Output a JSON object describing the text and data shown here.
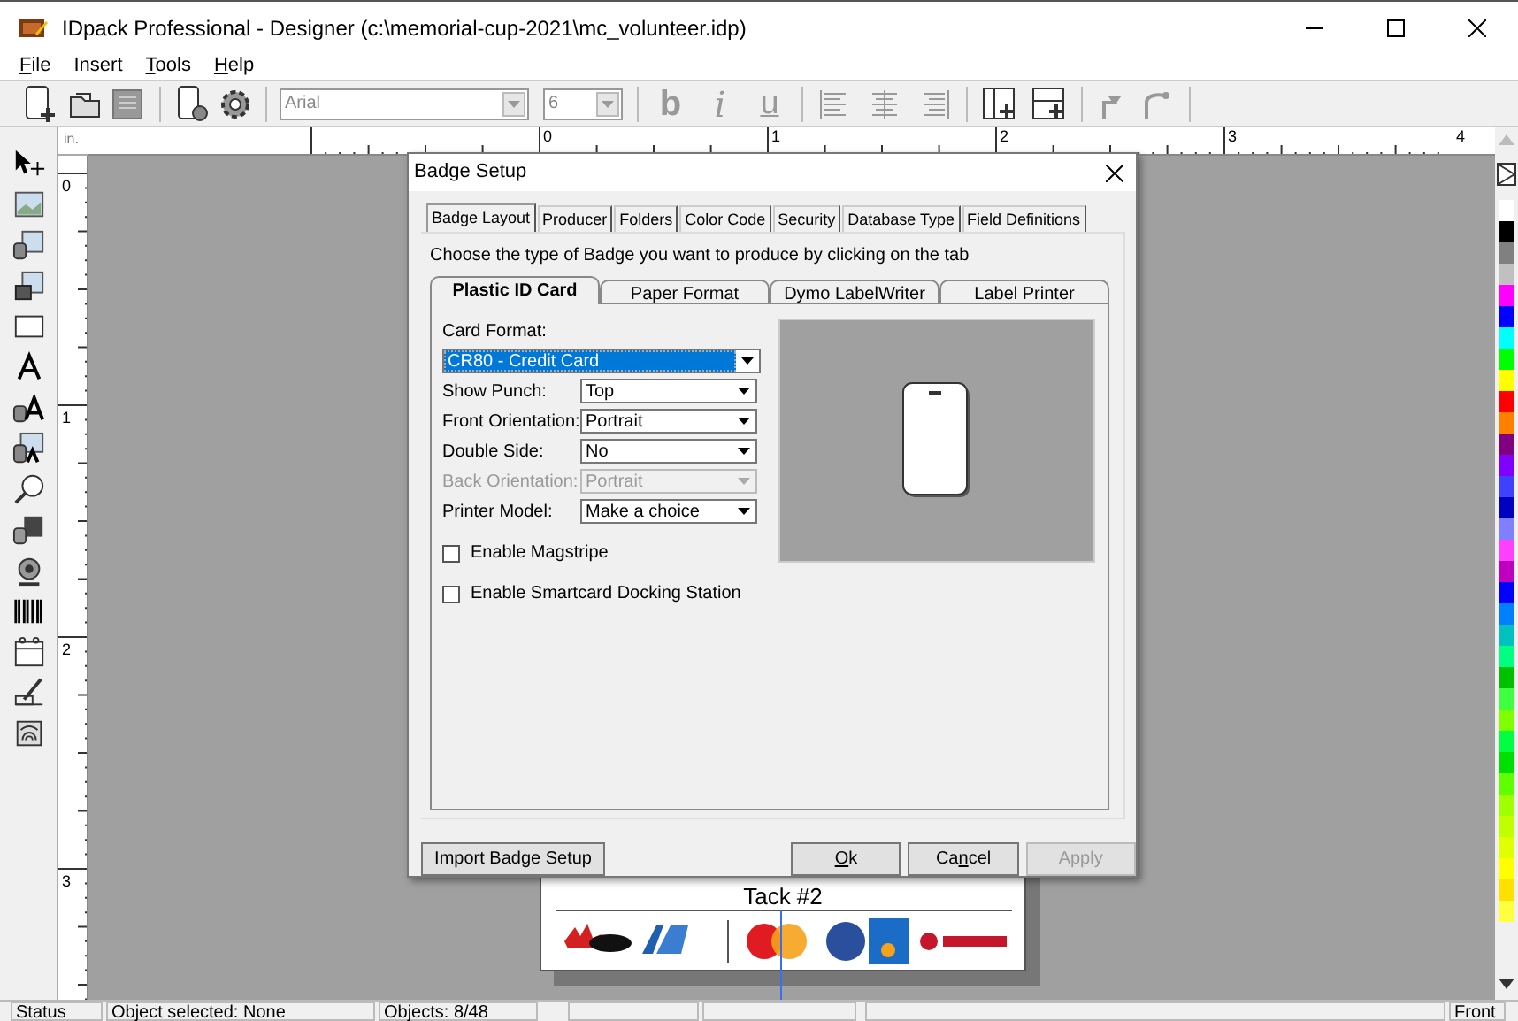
{
  "window": {
    "title": "IDpack Professional - Designer (c:\\memorial-cup-2021\\mc_volunteer.idp)"
  },
  "menu": [
    {
      "key": "F",
      "rest": "ile"
    },
    {
      "label": "Insert"
    },
    {
      "key": "T",
      "rest": "ools"
    },
    {
      "key": "H",
      "rest": "elp"
    }
  ],
  "toolbar": {
    "font": "Arial",
    "size": "6",
    "bold": "b",
    "italic": "i",
    "underline": "u"
  },
  "ruler": {
    "unit": "in.",
    "x_labels": [
      "0",
      "1",
      "2",
      "3",
      "4"
    ],
    "y_labels": [
      "0",
      "1",
      "2",
      "3"
    ]
  },
  "badge": {
    "text": "Tack #2"
  },
  "dialog": {
    "title": "Badge Setup",
    "tabs": [
      {
        "label": "Badge Layout",
        "selected": true
      },
      {
        "label": "Producer",
        "selected": false
      },
      {
        "label": "Folders",
        "selected": false
      },
      {
        "label": "Color Code",
        "selected": false
      },
      {
        "label": "Security",
        "selected": false
      },
      {
        "label": "Database Type",
        "selected": false
      },
      {
        "label": "Field Definitions",
        "selected": false
      }
    ],
    "hint": "Choose the type of Badge you want to produce by clicking on the tab",
    "card_tabs": [
      {
        "label": "Plastic ID Card",
        "selected": true
      },
      {
        "label": "Paper Format",
        "selected": false
      },
      {
        "label": "Dymo LabelWriter",
        "selected": false
      },
      {
        "label": "Label Printer",
        "selected": false
      }
    ],
    "card_format": {
      "label": "Card Format:",
      "value": "CR80 - Credit Card"
    },
    "fields": [
      {
        "label": "Show Punch:",
        "value": "Top",
        "disabled": false
      },
      {
        "label": "Front Orientation:",
        "value": "Portrait",
        "disabled": false
      },
      {
        "label": "Double Side:",
        "value": "No",
        "disabled": false
      },
      {
        "label": "Back Orientation:",
        "value": "Portrait",
        "disabled": true
      },
      {
        "label": "Printer Model:",
        "value": "Make a choice",
        "disabled": false
      }
    ],
    "checkboxes": [
      {
        "label": "Enable Magstripe",
        "checked": false
      },
      {
        "label": "Enable Smartcard Docking Station",
        "checked": false
      }
    ],
    "buttons": [
      {
        "label": "Import Badge Setup",
        "disabled": false
      },
      {
        "key": "O",
        "rest": "k",
        "disabled": false
      },
      {
        "lead": "Ca",
        "key": "n",
        "rest": "cel",
        "disabled": false
      },
      {
        "label": "Apply",
        "disabled": true
      }
    ]
  },
  "palette": [
    {
      "color": "#ffffff"
    },
    {
      "color": "#000000"
    },
    {
      "color": "#808080"
    },
    {
      "color": "#c0c0c0"
    },
    {
      "color": "#ff00ff"
    },
    {
      "color": "#0000ff"
    },
    {
      "color": "#00ffff"
    },
    {
      "color": "#00ff00"
    },
    {
      "color": "#ffff00"
    },
    {
      "color": "#ff0000"
    },
    {
      "color": "#ff8000"
    },
    {
      "color": "#800080"
    },
    {
      "color": "#8000ff"
    },
    {
      "color": "#4040ff"
    },
    {
      "color": "#0000c0"
    },
    {
      "color": "#8080ff"
    },
    {
      "color": "#ff40ff"
    },
    {
      "color": "#c000c0"
    },
    {
      "color": "#0000ff"
    },
    {
      "color": "#0080ff"
    },
    {
      "color": "#00c0c0"
    },
    {
      "color": "#00ff80"
    },
    {
      "color": "#00c000"
    },
    {
      "color": "#40ff40"
    },
    {
      "color": "#80ff00"
    },
    {
      "color": "#00ff40"
    },
    {
      "color": "#00e000"
    },
    {
      "color": "#60ff00"
    },
    {
      "color": "#a0ff00"
    },
    {
      "color": "#c0ff00"
    },
    {
      "color": "#e0ff00"
    },
    {
      "color": "#ffff00"
    },
    {
      "color": "#ffe000"
    },
    {
      "color": "#ffff40"
    }
  ],
  "status_bar": {
    "items": [
      "Status",
      "Object selected: None",
      "Objects: 8/48"
    ],
    "right": "Front"
  }
}
